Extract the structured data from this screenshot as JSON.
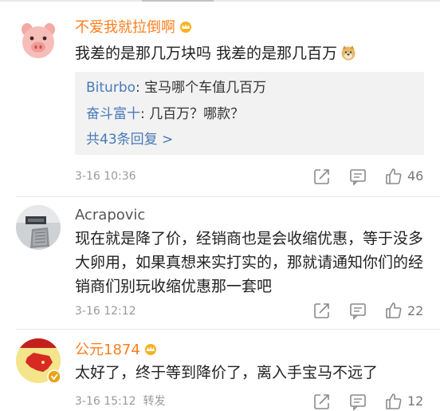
{
  "comments": [
    {
      "username": "不爱我就拉倒啊",
      "text": "我差的是那几万块吗 我差的是那几百万",
      "replies": [
        {
          "user": "Biturbo",
          "text": " 宝马哪个车值几百万"
        },
        {
          "user": "奋斗富十",
          "text": " 几百万？哪款？"
        }
      ],
      "more_replies": "共43条回复 >",
      "time": "3-16 10:36",
      "likes": "46"
    },
    {
      "username": "Acrapovic",
      "text": "现在就是降了价，经销商也是会收缩优惠，等于没多大卵用，如果真想来实打实的，那就请通知你们的经销商们别玩收缩优惠那一套吧",
      "time": "3-16 12:12",
      "likes": "22"
    },
    {
      "username": "公元1874",
      "text": "太好了，终于等到降价了，离入手宝马不远了",
      "time": "3-16 15:12",
      "source": "转发",
      "likes": "12"
    }
  ],
  "colors": {
    "vip_name": "#ff7e1d",
    "link_blue": "#4a79b8",
    "reply_bg": "#f2f2f2",
    "meta_gray": "#9a9a9a"
  },
  "icons": [
    "pig-avatar",
    "vip-crown-icon",
    "doge-emoji",
    "share-icon",
    "comment-icon",
    "like-icon",
    "verified-badge-icon"
  ]
}
